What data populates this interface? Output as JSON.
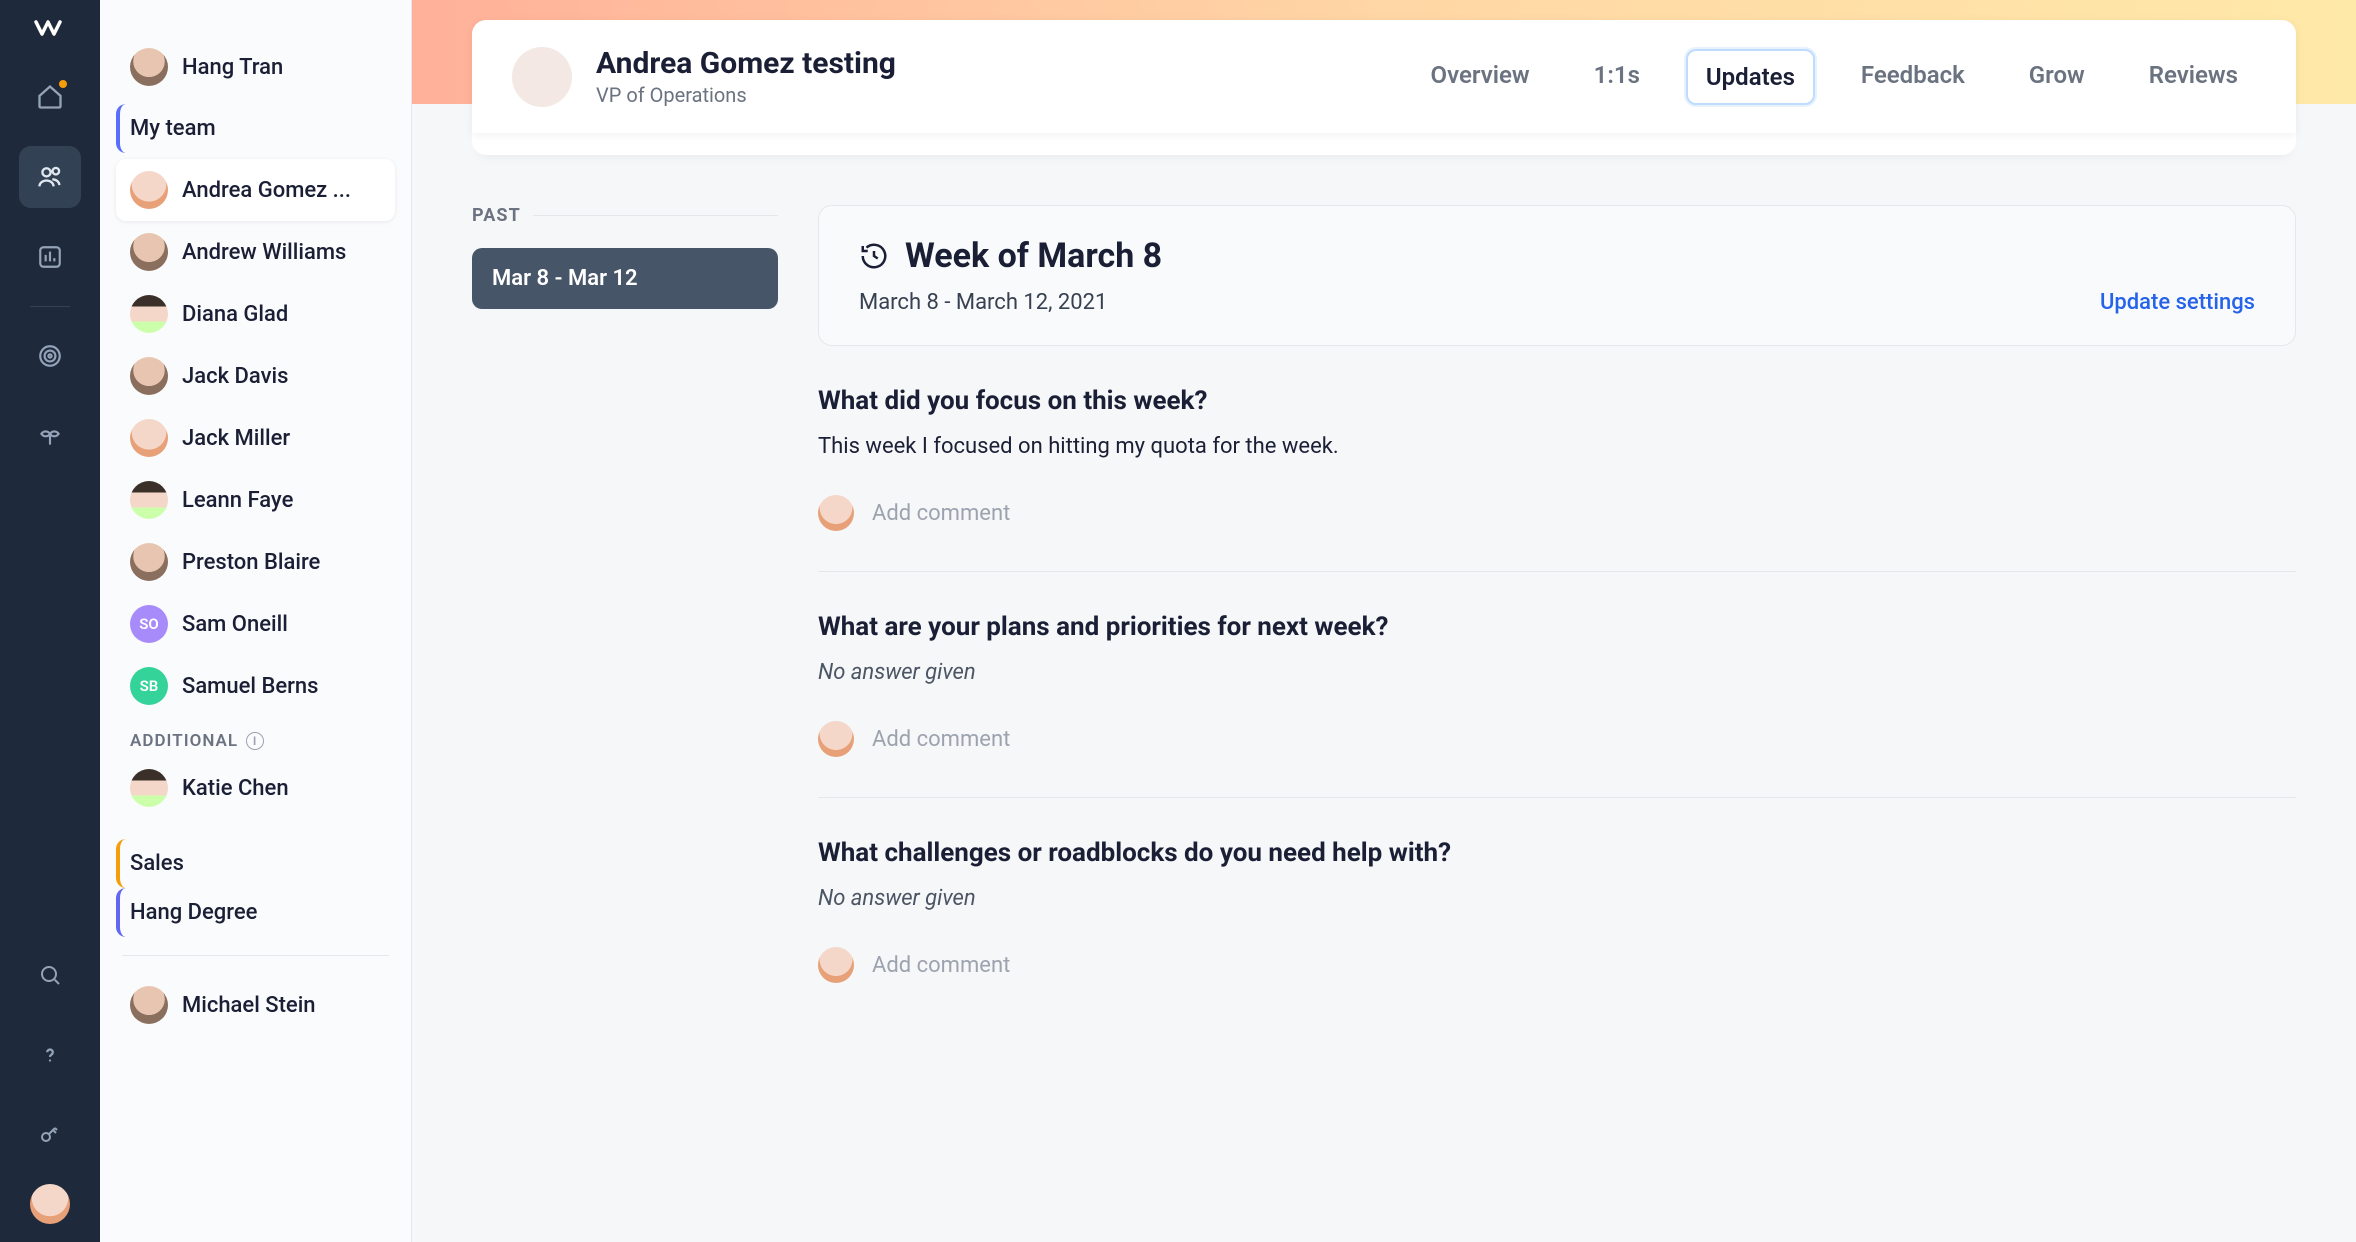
{
  "header": {
    "title": "Andrea Gomez testing",
    "subtitle": "VP of Operations",
    "tabs": {
      "overview": "Overview",
      "one_on_ones": "1:1s",
      "updates": "Updates",
      "feedback": "Feedback",
      "grow": "Grow",
      "reviews": "Reviews"
    }
  },
  "sidebar": {
    "current_user": "Hang Tran",
    "my_team": "My team",
    "team": [
      "Andrea Gomez ...",
      "Andrew Williams",
      "Diana Glad",
      "Jack Davis",
      "Jack Miller",
      "Leann Faye",
      "Preston Blaire",
      "Sam Oneill",
      "Samuel Berns"
    ],
    "additional_label": "ADDITIONAL",
    "additional": [
      "Katie Chen"
    ],
    "groups": {
      "sales": "Sales",
      "hang_degree": "Hang Degree"
    },
    "below": [
      "Michael Stein"
    ]
  },
  "timeline": {
    "past_label": "PAST",
    "ranges": [
      "Mar 8 - Mar 12"
    ]
  },
  "week": {
    "title": "Week of March 8",
    "sub": "March 8 - March 12, 2021",
    "settings": "Update settings"
  },
  "questions": [
    {
      "q": "What did you focus on this week?",
      "a": "This week I focused on hitting my quota for the week.",
      "empty": false
    },
    {
      "q": "What are your plans and priorities for next week?",
      "a": "No answer given",
      "empty": true
    },
    {
      "q": "What challenges or roadblocks do you need help with?",
      "a": "No answer given",
      "empty": true
    }
  ],
  "comment_placeholder": "Add comment",
  "avatar_initials": {
    "so": "SO",
    "sb": "SB"
  }
}
